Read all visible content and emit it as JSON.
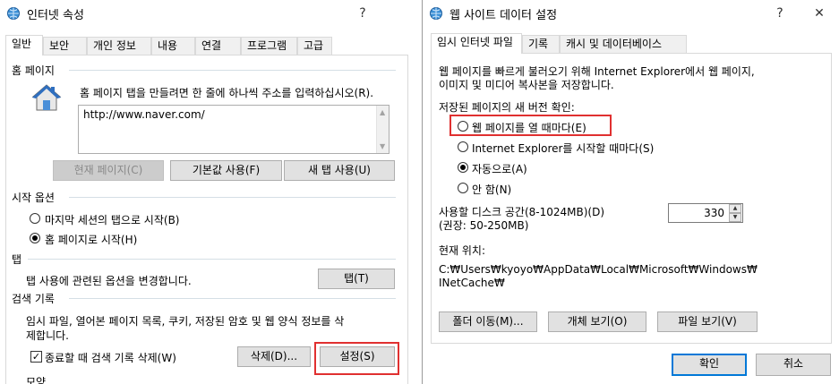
{
  "left": {
    "title": "인터넷 속성",
    "help": "?",
    "tabs": [
      "일반",
      "보안",
      "개인 정보",
      "내용",
      "연결",
      "프로그램",
      "고급"
    ],
    "home": {
      "heading": "홈 페이지",
      "instruction": "홈 페이지 탭을 만들려면 한 줄에 하나씩 주소를 입력하십시오(R).",
      "url": "http://www.naver.com/",
      "btn_current": "현재 페이지(C)",
      "btn_default": "기본값 사용(F)",
      "btn_newtab": "새 탭 사용(U)"
    },
    "startup": {
      "heading": "시작 옵션",
      "opt_last": "마지막 세션의 탭으로 시작(B)",
      "opt_home": "홈 페이지로 시작(H)"
    },
    "tabs_group": {
      "heading": "탭",
      "desc": "탭 사용에 관련된 옵션을 변경합니다.",
      "btn": "탭(T)"
    },
    "history": {
      "heading": "검색 기록",
      "desc_line1": "임시 파일, 열어본 페이지 목록, 쿠키, 저장된 암호 및 웹 양식 정보를 삭",
      "desc_line2": "제합니다.",
      "check_label": "종료할 때 검색 기록 삭제(W)",
      "btn_delete": "삭제(D)...",
      "btn_settings": "설정(S)"
    },
    "appearance_heading": "모양"
  },
  "right": {
    "title": "웹 사이트 데이터 설정",
    "help": "?",
    "close": "✕",
    "tabs": [
      "임시 인터넷 파일",
      "기록",
      "캐시 및 데이터베이스"
    ],
    "desc_line1": "웹 페이지를 빠르게 불러오기 위해 Internet Explorer에서 웹 페이지,",
    "desc_line2": "이미지 및 미디어 복사본을 저장합니다.",
    "check_heading": "저장된 페이지의 새 버전 확인:",
    "opt_every_visit": "웹 페이지를 열 때마다(E)",
    "opt_every_start": "Internet Explorer를 시작할 때마다(S)",
    "opt_auto": "자동으로(A)",
    "opt_never": "안 함(N)",
    "disk_label_line1": "사용할 디스크 공간(8-1024MB)(D)",
    "disk_label_line2": "(권장: 50-250MB)",
    "disk_value": "330",
    "location_label": "현재 위치:",
    "location_line1": "C:₩Users₩kyoyo₩AppData₩Local₩Microsoft₩Windows₩",
    "location_line2": "INetCache₩",
    "btn_move": "폴더 이동(M)...",
    "btn_objects": "개체 보기(O)",
    "btn_files": "파일 보기(V)",
    "btn_ok": "확인",
    "btn_cancel": "취소"
  },
  "colors": {
    "highlight": "#e03030",
    "accent": "#0078d7",
    "window_bg": "#f0f0f0"
  }
}
